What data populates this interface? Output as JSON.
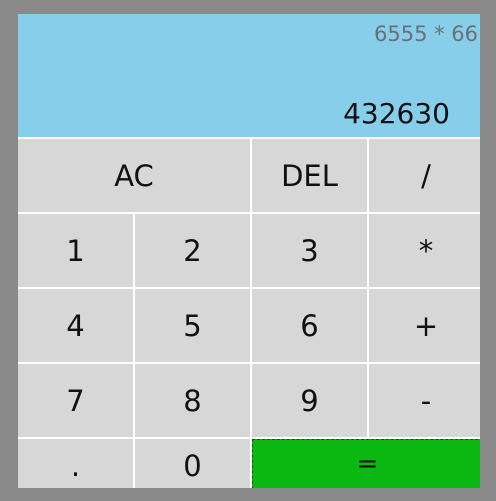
{
  "display": {
    "expression": "6555 * 66",
    "result": "432630"
  },
  "keys": {
    "ac": "AC",
    "del": "DEL",
    "divide": "/",
    "k1": "1",
    "k2": "2",
    "k3": "3",
    "multiply": "*",
    "k4": "4",
    "k5": "5",
    "k6": "6",
    "plus": "+",
    "k7": "7",
    "k8": "8",
    "k9": "9",
    "minus": "-",
    "dot": ".",
    "k0": "0",
    "equals": "="
  },
  "colors": {
    "display_bg": "#87ceeb",
    "key_bg": "#d7d7d7",
    "equals_bg": "#0cb812",
    "frame_bg": "#8a8a8a"
  }
}
